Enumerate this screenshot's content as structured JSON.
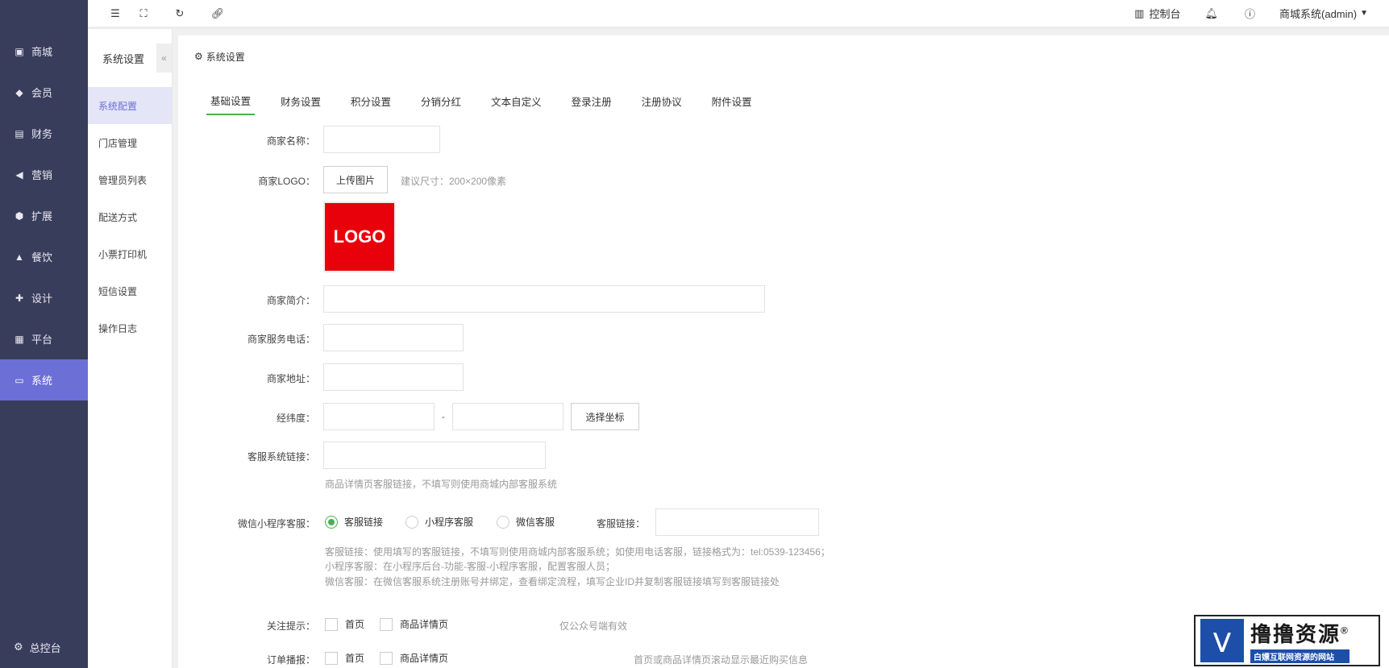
{
  "sidebar": {
    "items": [
      {
        "label": "商城",
        "icon": "shop-icon"
      },
      {
        "label": "会员",
        "icon": "member-icon"
      },
      {
        "label": "财务",
        "icon": "finance-icon"
      },
      {
        "label": "营销",
        "icon": "megaphone-icon"
      },
      {
        "label": "扩展",
        "icon": "cube-icon"
      },
      {
        "label": "餐饮",
        "icon": "dish-icon"
      },
      {
        "label": "设计",
        "icon": "puzzle-icon"
      },
      {
        "label": "平台",
        "icon": "grid-icon"
      },
      {
        "label": "系统",
        "icon": "monitor-icon"
      }
    ],
    "active_index": 8,
    "bottom_label": "总控台"
  },
  "topbar": {
    "console_label": "控制台",
    "user_label": "商城系统(admin)"
  },
  "subsidebar": {
    "title": "系统设置",
    "collapse_glyph": "«",
    "items": [
      "系统配置",
      "门店管理",
      "管理员列表",
      "配送方式",
      "小票打印机",
      "短信设置",
      "操作日志"
    ],
    "active_index": 0
  },
  "main": {
    "title": "系统设置",
    "tabs": [
      "基础设置",
      "财务设置",
      "积分设置",
      "分销分红",
      "文本自定义",
      "登录注册",
      "注册协议",
      "附件设置"
    ],
    "active_tab": 0
  },
  "form": {
    "shop_name_label": "商家名称：",
    "shop_name_value": "",
    "logo_label": "商家LOGO：",
    "upload_button": "上传图片",
    "logo_hint": "建议尺寸：200×200像素",
    "logo_preview_text": "LOGO",
    "intro_label": "商家简介：",
    "phone_label": "商家服务电话：",
    "address_label": "商家地址：",
    "coord_label": "经纬度：",
    "coord_sep": "-",
    "select_coord_button": "选择坐标",
    "cs_link_label": "客服系统链接：",
    "cs_link_hint": "商品详情页客服链接，不填写则使用商城内部客服系统",
    "wx_cs_label": "微信小程序客服：",
    "wx_cs_options": [
      "客服链接",
      "小程序客服",
      "微信客服"
    ],
    "wx_cs_selected": 0,
    "wx_cs_link_label": "客服链接：",
    "wx_cs_hint_1": "客服链接：使用填写的客服链接，不填写则使用商城内部客服系统；如使用电话客服，链接格式为：tel:0539-123456；",
    "wx_cs_hint_2": "小程序客服：在小程序后台-功能-客服-小程序客服，配置客服人员；",
    "wx_cs_hint_3": "微信客服：在微信客服系统注册账号并绑定，查看绑定流程，填写企业ID并复制客服链接填写到客服链接处",
    "follow_label": "关注提示：",
    "follow_opts": [
      "首页",
      "商品详情页"
    ],
    "follow_hint": "仅公众号端有效",
    "order_label": "订单播报：",
    "order_opts": [
      "首页",
      "商品详情页"
    ],
    "order_hint": "首页或商品详情页滚动显示最近购买信息"
  },
  "watermark": {
    "title": "撸撸资源",
    "reg": "®",
    "subtitle": "白嫖互联网资源的网站"
  },
  "colors": {
    "sidebar_bg": "#393d5c",
    "accent": "#6b6fd6",
    "tab_active": "#4caf50",
    "logo_red": "#e8000b"
  }
}
